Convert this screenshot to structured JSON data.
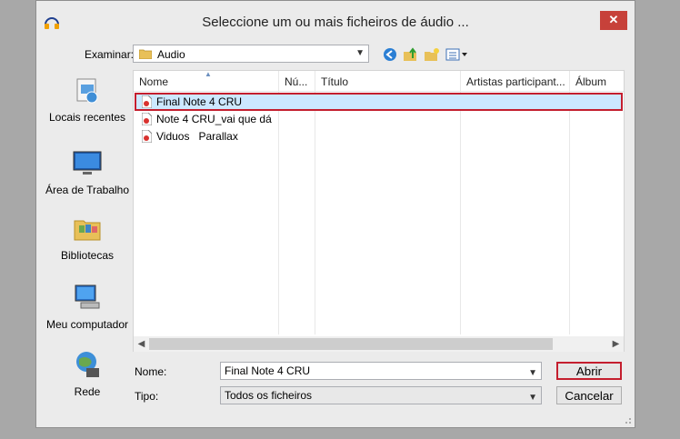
{
  "window": {
    "title": "Seleccione um ou mais ficheiros de áudio ...",
    "close_glyph": "✕"
  },
  "toolbar": {
    "look_in_label": "Examinar:",
    "look_in_value": "Audio",
    "icons": [
      "back-icon",
      "up-folder-icon",
      "new-folder-icon",
      "view-menu-icon"
    ]
  },
  "places": [
    {
      "label": "Locais recentes",
      "icon": "recent-places-icon"
    },
    {
      "label": "Área de Trabalho",
      "icon": "desktop-icon"
    },
    {
      "label": "Bibliotecas",
      "icon": "libraries-icon"
    },
    {
      "label": "Meu computador",
      "icon": "computer-icon"
    },
    {
      "label": "Rede",
      "icon": "network-icon"
    }
  ],
  "columns": [
    "Nome",
    "Nú...",
    "Título",
    "Artistas participant...",
    "Álbum"
  ],
  "files": [
    {
      "name": "Final Note 4 CRU",
      "selected": true
    },
    {
      "name": "Note 4 CRU_vai que dá",
      "selected": false
    },
    {
      "name": "Viduos   Parallax",
      "selected": false
    }
  ],
  "form": {
    "name_label": "Nome:",
    "name_value": "Final Note 4 CRU",
    "type_label": "Tipo:",
    "type_value": "Todos os ficheiros",
    "open_button": "Abrir",
    "cancel_button": "Cancelar"
  },
  "colors": {
    "selection": "#cce8ff",
    "highlight_outline": "#c41e2e",
    "close_button": "#c7413a"
  }
}
